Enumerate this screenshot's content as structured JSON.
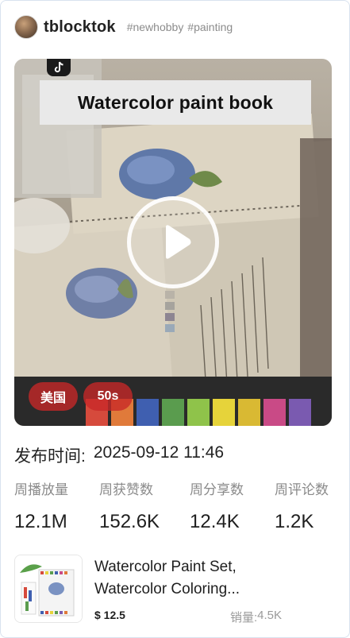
{
  "author": {
    "name": "tblocktok",
    "hashtags": [
      "#newhobby",
      "#painting"
    ]
  },
  "video": {
    "banner_text": "Watercolor paint book",
    "region_tag": "美国",
    "duration_tag": "50s"
  },
  "publish": {
    "label": "发布时间:",
    "value": "2025-09-12 11:46"
  },
  "stats": [
    {
      "label": "周播放量",
      "value": "12.1M"
    },
    {
      "label": "周获赞数",
      "value": "152.6K"
    },
    {
      "label": "周分享数",
      "value": "12.4K"
    },
    {
      "label": "周评论数",
      "value": "1.2K"
    }
  ],
  "product": {
    "title_line1": "Watercolor Paint Set,",
    "title_line2": "Watercolor Coloring...",
    "price": "$ 12.5",
    "sales_label": "销量:",
    "sales_value": "4.5K"
  },
  "colors": {
    "tag_background": "#c82828",
    "label_gray": "#8a8a8a",
    "card_border": "#d9e3ef"
  }
}
